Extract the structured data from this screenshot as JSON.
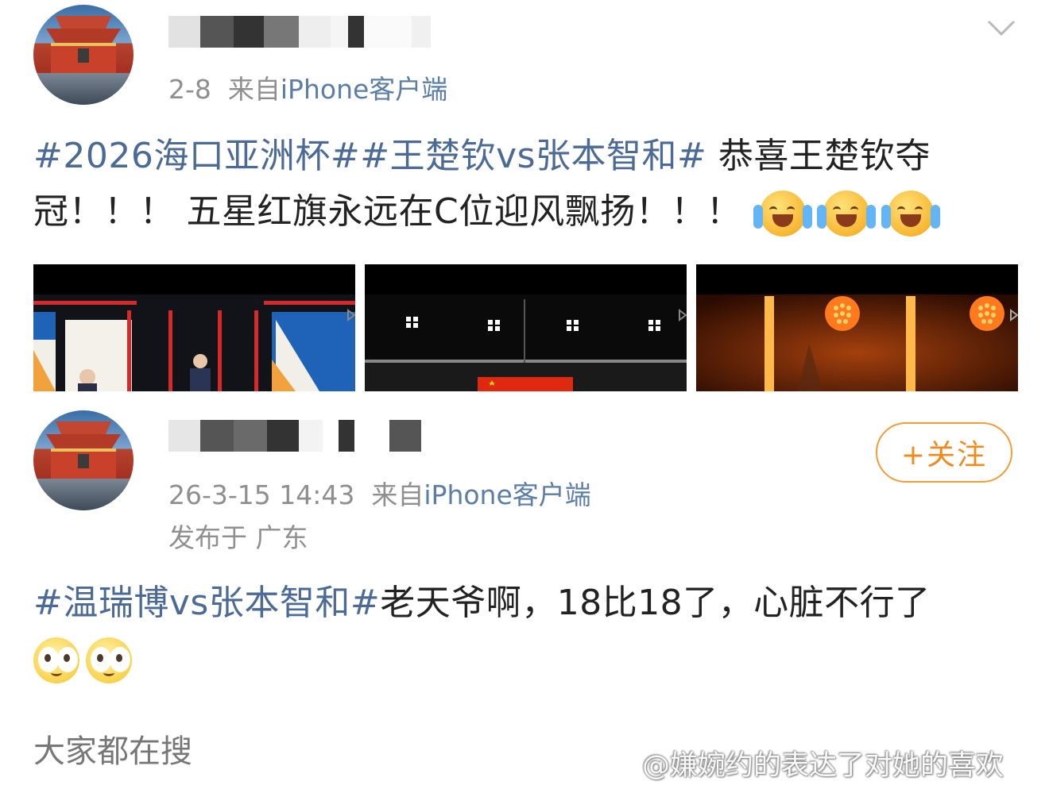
{
  "posts": [
    {
      "date": "2-8",
      "source_prefix": "来自",
      "source": "iPhone客户端",
      "text_hashtags": "#2026海口亚洲杯##王楚钦vs张本智和#",
      "text_body_1": " 恭喜王楚钦夺",
      "text_body_2": "冠！！！ 五星红旗永远在C位迎风飘扬！！！",
      "emojis": [
        "laughing-tears-icon",
        "laughing-tears-icon",
        "laughing-tears-icon"
      ]
    },
    {
      "date": "26-3-15 14:43",
      "source_prefix": "来自",
      "source": "iPhone客户端",
      "location": "发布于 广东",
      "follow_label": "+关注",
      "text_hashtag": "#温瑞博vs张本智和#",
      "text_body": "老天爷啊，18比18了，心脏不行了",
      "emojis": [
        "dizzy-eyes-icon",
        "dizzy-eyes-icon"
      ]
    }
  ],
  "everyone_searching": "大家都在搜",
  "watermark": "@嫌婉约的表达了对她的喜欢",
  "colors": {
    "hashtag": "#4c6a96",
    "source": "#5b7da6",
    "meta": "#8f8f8f",
    "follow": "#f08a1f"
  }
}
